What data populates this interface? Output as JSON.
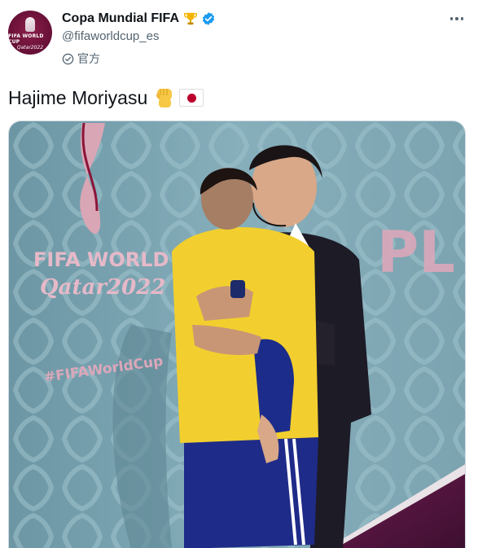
{
  "account": {
    "display_name": "Copa Mundial FIFA",
    "handle": "@fifaworldcup_es",
    "official_label": "官方",
    "avatar_text_1": "FIFA WORLD CUP",
    "avatar_text_2": "Qatar2022",
    "emoji": "trophy",
    "badge": "verified-badge"
  },
  "tweet": {
    "text": "Hajime Moriyasu",
    "emojis": [
      "raised-fist",
      "flag-japan"
    ]
  },
  "media": {
    "backdrop_text_1": "FIFA WORLD CUP",
    "backdrop_text_2": "Qatar2022",
    "hashtag_text": "#FIFAWorldCup",
    "wall_letters": "PL"
  },
  "colors": {
    "text_primary": "#0f1419",
    "text_secondary": "#536471",
    "verified_blue": "#1d9bf0",
    "wall_blue": "#7ea6b3",
    "qatar_maroon": "#8a1538",
    "jersey_yellow": "#f2cf2e",
    "flag_red": "#bc002d"
  }
}
